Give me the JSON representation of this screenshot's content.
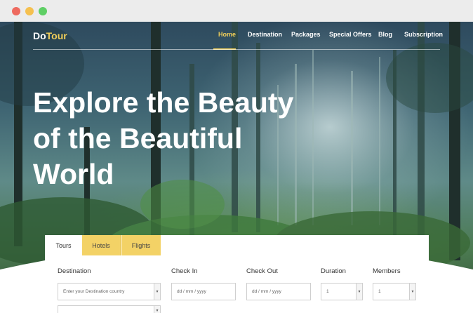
{
  "site": {
    "logo_part1": "Do",
    "logo_part2": "Tour",
    "accent_color": "#f0ce5a"
  },
  "nav": {
    "items": [
      {
        "label": "Home",
        "active": true
      },
      {
        "label": "Destination",
        "active": false
      },
      {
        "label": "Packages",
        "active": false
      },
      {
        "label": "Special Offers",
        "active": false
      },
      {
        "label": "Blog",
        "active": false
      },
      {
        "label": "Subscription",
        "active": false
      }
    ]
  },
  "hero": {
    "headline_lines": [
      "Explore the Beauty",
      "of the Beautiful",
      "World"
    ]
  },
  "search": {
    "tabs": [
      {
        "label": "Tours",
        "active": true
      },
      {
        "label": "Hotels",
        "active": false
      },
      {
        "label": "Flights",
        "active": false
      }
    ],
    "destination": {
      "label": "Destination",
      "placeholder": "Enter your Destination country"
    },
    "check_in": {
      "label": "Check In",
      "placeholder": "dd / mm / yyyy"
    },
    "check_out": {
      "label": "Check Out",
      "placeholder": "dd / mm / yyyy"
    },
    "duration": {
      "label": "Duration",
      "value": "1"
    },
    "members": {
      "label": "Members",
      "value": "1"
    }
  },
  "icons": {
    "dropdown": "chevron-down-icon",
    "window_controls": [
      "close-dot",
      "minimize-dot",
      "maximize-dot"
    ]
  }
}
